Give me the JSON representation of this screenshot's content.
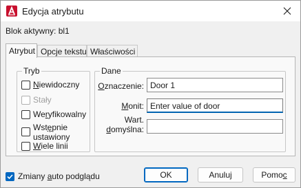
{
  "window": {
    "title": "Edycja atrybutu",
    "close_icon": "close-icon",
    "app_icon": "autocad-a-icon"
  },
  "block_label": "Blok aktywny: bl1",
  "tabs": [
    {
      "label": "Atrybut",
      "active": true
    },
    {
      "label": "Opcje tekstu",
      "active": false
    },
    {
      "label": "Właściwości",
      "active": false
    }
  ],
  "mode_group": {
    "title": "Tryb",
    "options": [
      {
        "label": "Niewidoczny",
        "checked": false,
        "enabled": true
      },
      {
        "label": "Stały",
        "checked": false,
        "enabled": false
      },
      {
        "label": "Weryfikowalny",
        "checked": false,
        "enabled": true
      },
      {
        "label": "Wstępnie ustawiony",
        "checked": false,
        "enabled": true
      },
      {
        "label": "Wiele linii",
        "checked": false,
        "enabled": true
      }
    ]
  },
  "data_group": {
    "title": "Dane",
    "tag_label": "Oznaczenie:",
    "tag_value": "Door 1",
    "prompt_label": "Monit:",
    "prompt_value": "Enter value of door",
    "default_label_line1": "Wart.",
    "default_label_line2": "domyślna:",
    "default_value": ""
  },
  "auto_preview": {
    "label": "Zmiany auto podglądu",
    "checked": true
  },
  "buttons": {
    "ok": "OK",
    "cancel": "Anuluj",
    "help": "Pomoc"
  },
  "colors": {
    "accent": "#0067c0",
    "app_icon": "#c8102e"
  }
}
